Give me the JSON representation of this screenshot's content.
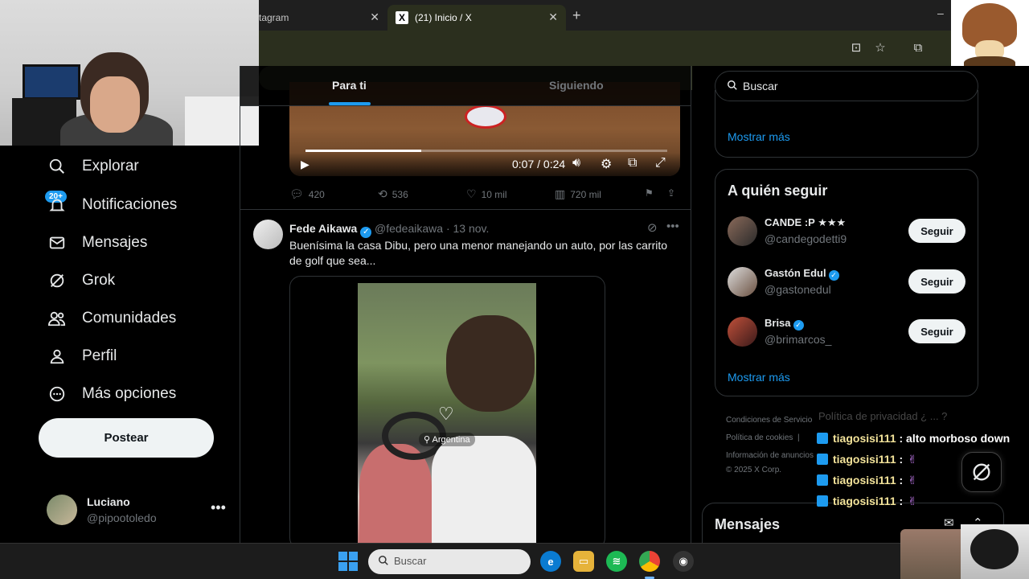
{
  "browser": {
    "tabs": [
      {
        "label": "tagram",
        "active": false
      },
      {
        "label": "(21) Inicio / X",
        "active": true
      }
    ],
    "new_tab": "+",
    "close_glyph": "✕"
  },
  "nav": {
    "items": [
      {
        "label": "Explorar",
        "icon": "search-icon"
      },
      {
        "label": "Notificaciones",
        "icon": "bell-icon"
      },
      {
        "label": "Mensajes",
        "icon": "mail-icon"
      },
      {
        "label": "Grok",
        "icon": "grok-icon"
      },
      {
        "label": "Comunidades",
        "icon": "people-icon"
      },
      {
        "label": "Perfil",
        "icon": "person-icon"
      },
      {
        "label": "Más opciones",
        "icon": "more-circle-icon"
      }
    ],
    "notif_badge": "20+",
    "post_button": "Postear",
    "account": {
      "name": "Luciano",
      "handle": "@pipootoledo"
    }
  },
  "feed": {
    "tabs": [
      "Para ti",
      "Siguiendo"
    ],
    "video1": {
      "time": "0:07 / 0:24",
      "progress": 0.32
    },
    "post1_actions": {
      "replies": "420",
      "reposts": "536",
      "likes": "10 mil",
      "views": "720 mil"
    },
    "post2": {
      "name": "Fede Aikawa",
      "handle": "@fedeaikawa",
      "date": "· 13 nov.",
      "text": "Buenísima la casa Dibu, pero una menor manejando un auto, por las carrito de golf que sea...",
      "location": "Argentina"
    }
  },
  "right": {
    "search_placeholder": "Buscar",
    "show_more": "Mostrar más",
    "who_to_follow": {
      "title": "A quién seguir",
      "users": [
        {
          "name": "CANDE :P ★★★",
          "handle": "@candegodetti9",
          "verified": false,
          "button": "Seguir"
        },
        {
          "name": "Gastón Edul",
          "handle": "@gastonedul",
          "verified": true,
          "button": "Seguir"
        },
        {
          "name": "Brisa",
          "handle": "@brimarcos_",
          "verified": true,
          "button": "Seguir"
        }
      ]
    },
    "footer": {
      "line1": "Condiciones de Servicio",
      "line2a": "Política de cookies",
      "line2b": "|",
      "line3": "Información de anuncios",
      "copyright": "© 2025 X Corp."
    },
    "messages_title": "Mensajes"
  },
  "chat": {
    "faded": "Política de privacidad  ¿ ... ?",
    "lines": [
      {
        "user": "tiagosisi111",
        "text": ": alto morboso down",
        "emote": ""
      },
      {
        "user": "tiagosisi111",
        "text": ":",
        "emote": "✌"
      },
      {
        "user": "tiagosisi111",
        "text": ":",
        "emote": "✌"
      },
      {
        "user": "tiagosisi111",
        "text": ":",
        "emote": "✌"
      }
    ]
  },
  "taskbar": {
    "search_label": "Buscar"
  },
  "colors": {
    "accent": "#1d9bf0",
    "background": "#000000",
    "chrome": "#2b2f1e"
  }
}
